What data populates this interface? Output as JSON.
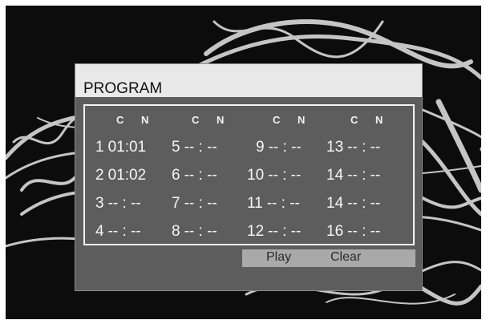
{
  "dialog": {
    "title": "PROGRAM",
    "column_headers": [
      {
        "c": "C",
        "n": "N"
      },
      {
        "c": "C",
        "n": "N"
      },
      {
        "c": "C",
        "n": "N"
      },
      {
        "c": "C",
        "n": "N"
      }
    ],
    "slots": [
      {
        "num": "1",
        "value": "01:01"
      },
      {
        "num": "5",
        "value": "-- : --"
      },
      {
        "num": "9",
        "value": "-- : --"
      },
      {
        "num": "13",
        "value": "-- : --"
      },
      {
        "num": "2",
        "value": "01:02"
      },
      {
        "num": "6",
        "value": "-- : --"
      },
      {
        "num": "10",
        "value": "-- : --"
      },
      {
        "num": "14",
        "value": "-- : --"
      },
      {
        "num": "3",
        "value": "-- : --"
      },
      {
        "num": "7",
        "value": "-- : --"
      },
      {
        "num": "11",
        "value": "-- : --"
      },
      {
        "num": "14",
        "value": "-- : --"
      },
      {
        "num": "4",
        "value": "-- : --"
      },
      {
        "num": "8",
        "value": "-- : --"
      },
      {
        "num": "12",
        "value": "-- : --"
      },
      {
        "num": "16",
        "value": "-- : --"
      }
    ],
    "buttons": {
      "play": "Play",
      "clear": "Clear"
    }
  },
  "colors": {
    "screen_background": "#0c0c0c",
    "dialog_body": "#5d5d5d",
    "title_bar": "#e9e9e9",
    "button_bar": "#a9a9a9"
  }
}
